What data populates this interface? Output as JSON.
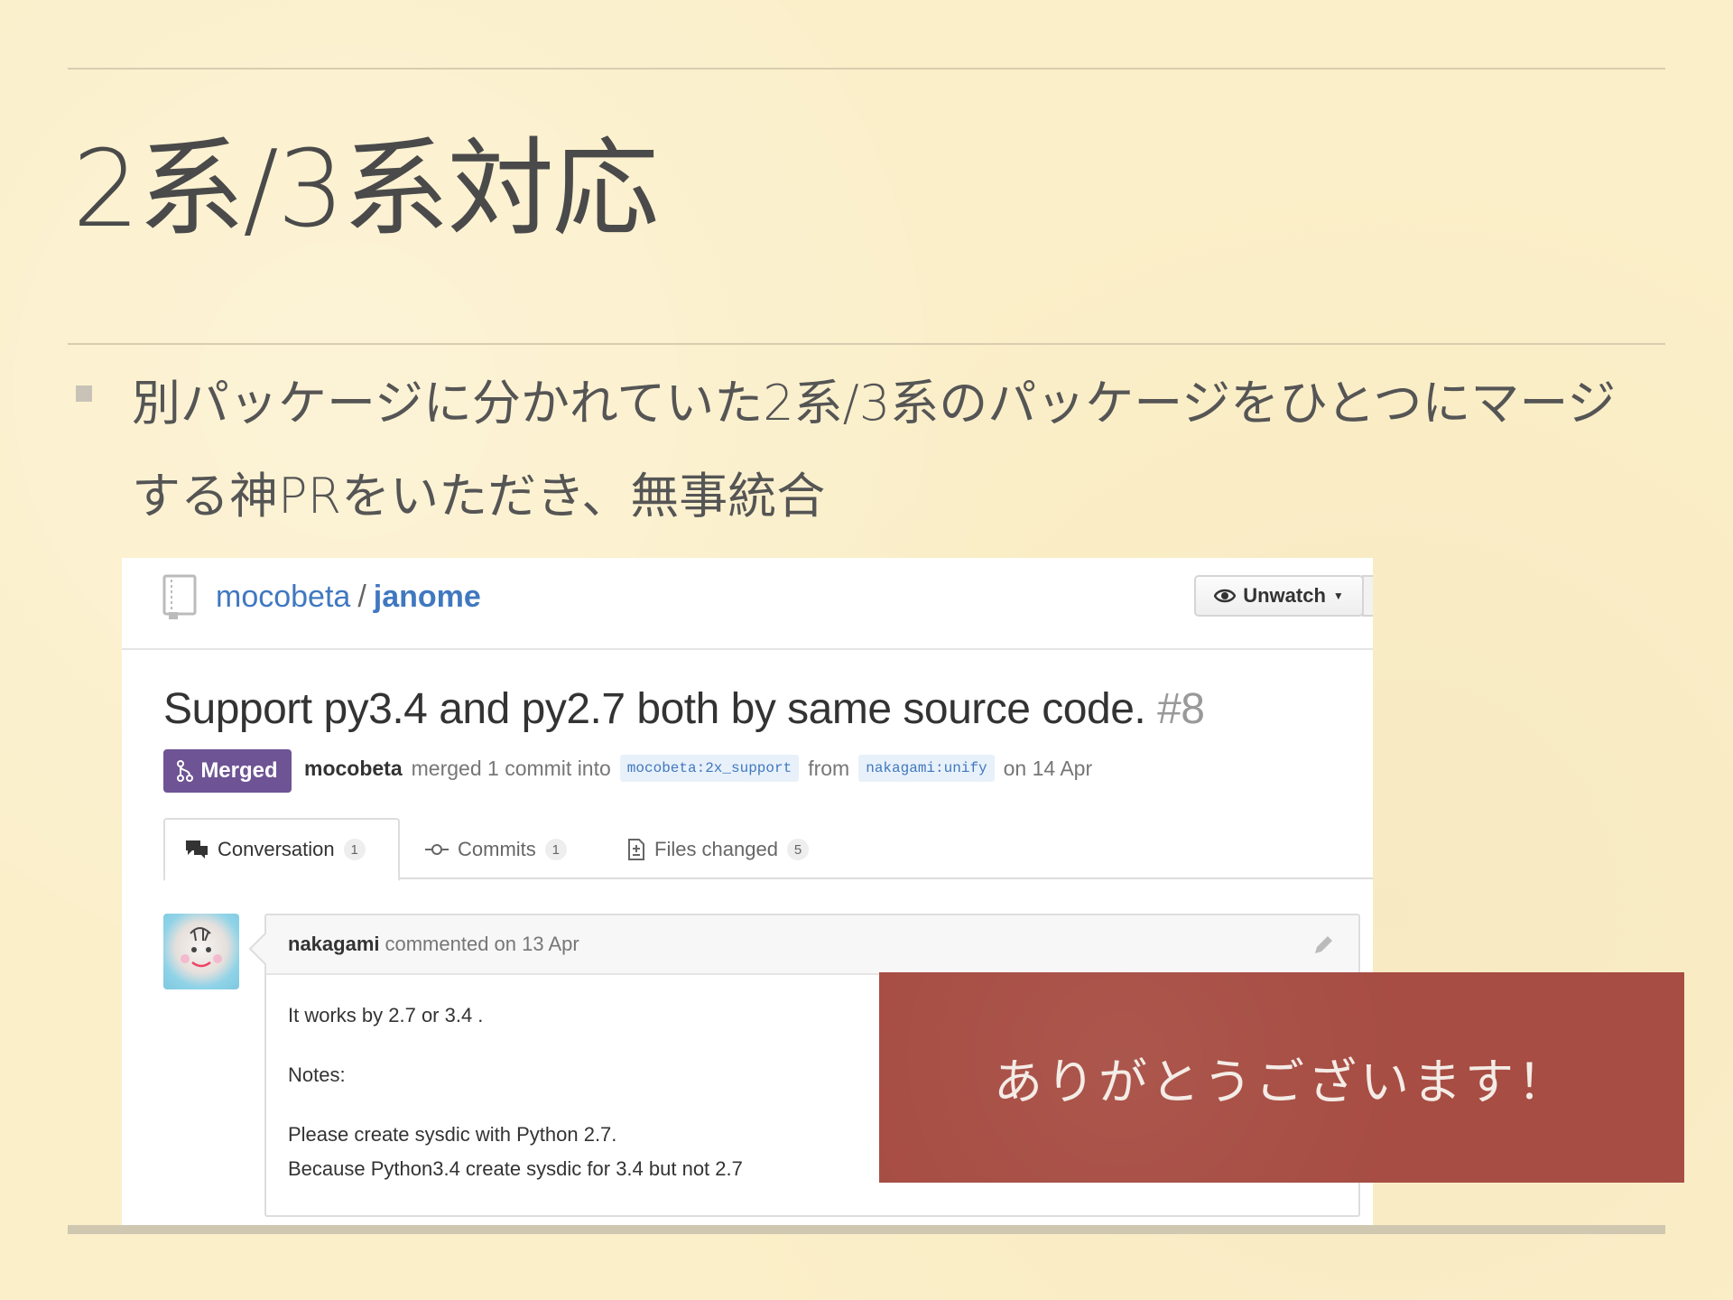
{
  "slide": {
    "title": "2系/3系対応",
    "bullet": "別パッケージに分かれていた2系/3系のパッケージをひとつにマージする神PRをいただき、無事統合"
  },
  "github": {
    "owner": "mocobeta",
    "separator": "/",
    "repo": "janome",
    "watch_label": "Unwatch",
    "pr_title": "Support py3.4 and py2.7 both by same source code.",
    "pr_number": "#8",
    "status_label": "Merged",
    "merge_user": "mocobeta",
    "merge_text": "merged 1 commit into",
    "base_branch": "mocobeta:2x_support",
    "from_text": "from",
    "head_branch": "nakagami:unify",
    "merge_date": "on 14 Apr",
    "tabs": [
      {
        "label": "Conversation",
        "count": "1"
      },
      {
        "label": "Commits",
        "count": "1"
      },
      {
        "label": "Files changed",
        "count": "5"
      }
    ],
    "comment": {
      "author": "nakagami",
      "meta": "commented on 13 Apr",
      "lines": [
        "It works by 2.7 or 3.4 .",
        "Notes:",
        "Please create sysdic with Python 2.7.",
        "Because Python3.4 create sysdic for 3.4 but not 2.7"
      ]
    }
  },
  "overlay": {
    "thanks": "ありがとうございます！"
  },
  "colors": {
    "background": "#fbefc9",
    "merged": "#6e5494",
    "link": "#4078c0",
    "overlay": "#a74d43"
  }
}
